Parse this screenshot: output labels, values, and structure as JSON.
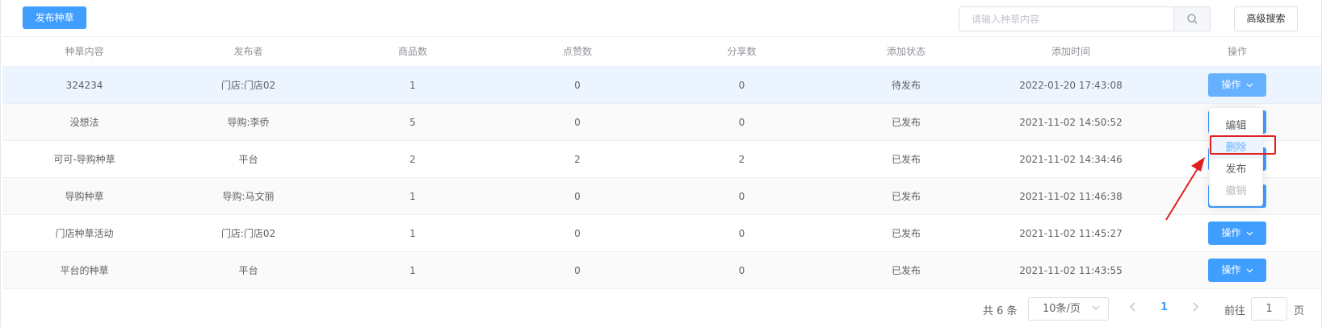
{
  "toolbar": {
    "publish_label": "发布种草",
    "search_placeholder": "请输入种草内容",
    "advanced_label": "高级搜索"
  },
  "table": {
    "headers": [
      "种草内容",
      "发布者",
      "商品数",
      "点赞数",
      "分享数",
      "添加状态",
      "添加时间",
      "操作"
    ],
    "rows": [
      [
        "324234",
        "门店:门店02",
        "1",
        "0",
        "0",
        "待发布",
        "2022-01-20 17:43:08"
      ],
      [
        "没想法",
        "导购:李侨",
        "5",
        "0",
        "0",
        "已发布",
        "2021-11-02 14:50:52"
      ],
      [
        "可可-导购种草",
        "平台",
        "2",
        "2",
        "2",
        "已发布",
        "2021-11-02 14:34:46"
      ],
      [
        "导购种草",
        "导购:马文丽",
        "1",
        "0",
        "0",
        "已发布",
        "2021-11-02 11:46:38"
      ],
      [
        "门店种草活动",
        "门店:门店02",
        "1",
        "0",
        "0",
        "已发布",
        "2021-11-02 11:45:27"
      ],
      [
        "平台的种草",
        "平台",
        "1",
        "0",
        "0",
        "已发布",
        "2021-11-02 11:43:55"
      ]
    ],
    "action_label": "操作"
  },
  "dropdown": {
    "items": [
      "编辑",
      "删除",
      "发布",
      "撤销"
    ]
  },
  "pagination": {
    "total": "共 6 条",
    "page_size": "10条/页",
    "current_page": "1",
    "goto_prefix": "前往",
    "goto_value": "1",
    "goto_suffix": "页"
  },
  "colors": {
    "primary": "#409eff",
    "highlight": "#e02020"
  }
}
